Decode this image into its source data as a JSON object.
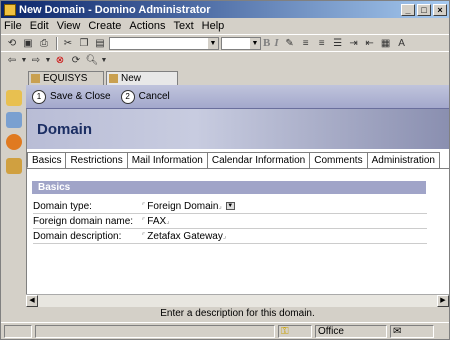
{
  "window": {
    "title": "New Domain - Domino Administrator"
  },
  "menu": [
    "File",
    "Edit",
    "View",
    "Create",
    "Actions",
    "Text",
    "Help"
  ],
  "tabs": [
    {
      "label": "EQUISYS Domain"
    },
    {
      "label": "New Domain"
    }
  ],
  "actions": [
    {
      "label": "Save & Close",
      "number": "1"
    },
    {
      "label": "Cancel",
      "number": "2"
    }
  ],
  "banner": {
    "title": "Domain"
  },
  "doc_tabs": [
    "Basics",
    "Restrictions",
    "Mail Information",
    "Calendar Information",
    "Comments",
    "Administration"
  ],
  "section": {
    "title": "Basics"
  },
  "fields": [
    {
      "label": "Domain type:",
      "value": "Foreign Domain"
    },
    {
      "label": "Foreign domain name:",
      "value": "FAX"
    },
    {
      "label": "Domain description:",
      "value": "Zetafax Gateway"
    }
  ],
  "hint": "Enter a description for this domain.",
  "status": {
    "location": "Office"
  },
  "colors": {
    "accent": "#1b2e63",
    "section": "#a0a4c8"
  }
}
